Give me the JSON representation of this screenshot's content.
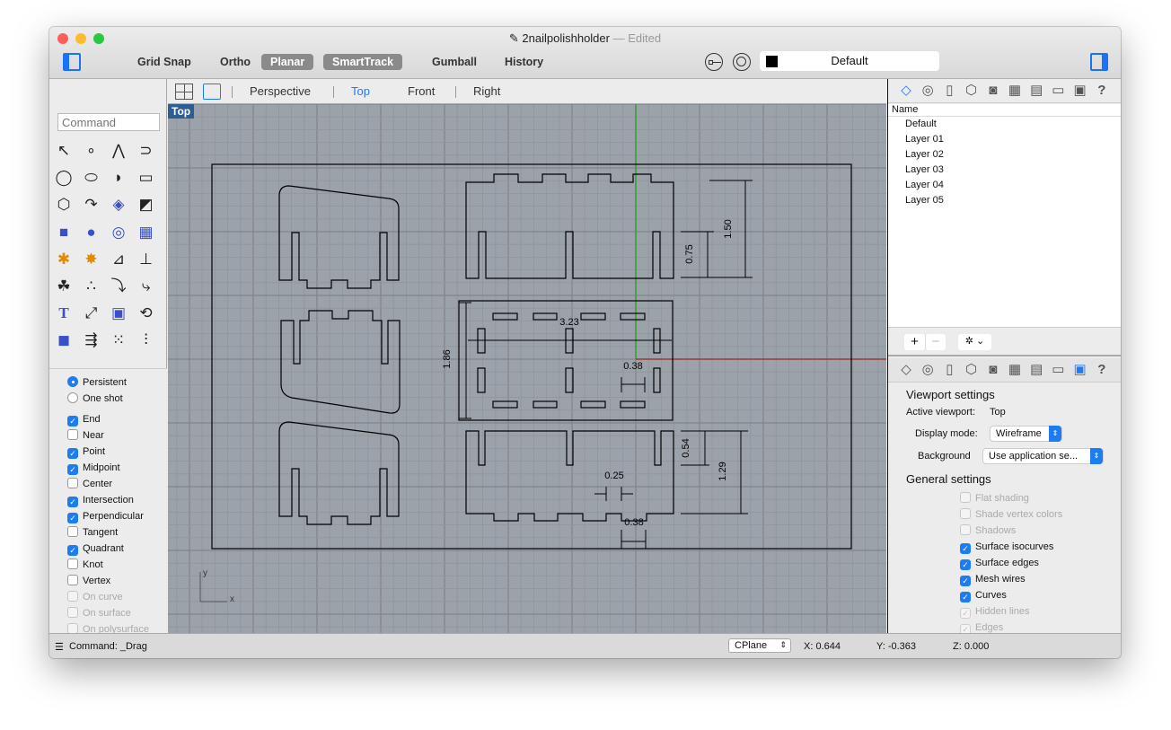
{
  "window": {
    "title": "2nailpolishholder",
    "edited": "— Edited"
  },
  "toolbar": {
    "buttons": [
      {
        "label": "Grid Snap",
        "on": false
      },
      {
        "label": "Ortho",
        "on": false
      },
      {
        "label": "Planar",
        "on": true
      },
      {
        "label": "SmartTrack",
        "on": true
      },
      {
        "label": "Gumball",
        "on": false
      },
      {
        "label": "History",
        "on": false
      }
    ],
    "layer": "Default"
  },
  "command": {
    "placeholder": "Command"
  },
  "tools": [
    "select-arrow",
    "point",
    "polyline",
    "curve",
    "circle",
    "ellipse",
    "arc",
    "rectangle",
    "polygon",
    "fillet",
    "surface-from-points",
    "sweep-surface",
    "box",
    "spheres",
    "cylinder",
    "patch-surface",
    "boolean",
    "explode",
    "trim",
    "split",
    "boolean-union",
    "points-on-curve",
    "offset-curve",
    "blend-curve",
    "text",
    "move",
    "array-blocks",
    "rotate",
    "extrude-solid",
    "dimension",
    "grid-array",
    "section",
    "more"
  ],
  "osnap": {
    "modes": [
      {
        "label": "Persistent",
        "selected": true
      },
      {
        "label": "One shot",
        "selected": false
      }
    ],
    "items": [
      {
        "label": "End",
        "checked": true
      },
      {
        "label": "Near",
        "checked": false
      },
      {
        "label": "Point",
        "checked": true
      },
      {
        "label": "Midpoint",
        "checked": true
      },
      {
        "label": "Center",
        "checked": false
      },
      {
        "label": "Intersection",
        "checked": true
      },
      {
        "label": "Perpendicular",
        "checked": true
      },
      {
        "label": "Tangent",
        "checked": false
      },
      {
        "label": "Quadrant",
        "checked": true
      },
      {
        "label": "Knot",
        "checked": false
      },
      {
        "label": "Vertex",
        "checked": false
      },
      {
        "label": "On curve",
        "checked": false,
        "disabled": true
      },
      {
        "label": "On surface",
        "checked": false,
        "disabled": true
      },
      {
        "label": "On polysurface",
        "checked": false,
        "disabled": true
      }
    ]
  },
  "viewport_tabs": [
    {
      "label": "Perspective",
      "active": false
    },
    {
      "label": "Top",
      "active": true
    },
    {
      "label": "Front",
      "active": false
    },
    {
      "label": "Right",
      "active": false
    }
  ],
  "viewport": {
    "name": "Top",
    "axis_x": "x",
    "axis_y": "y",
    "dimensions": {
      "d150": "1.50",
      "d075": "0.75",
      "d186": "1.86",
      "d323": "3.23",
      "d038a": "0.38",
      "d054": "0.54",
      "d129": "1.29",
      "d025": "0.25",
      "d038b": "0.38"
    }
  },
  "layers": {
    "header": "Name",
    "items": [
      "Default",
      "Layer 01",
      "Layer 02",
      "Layer 03",
      "Layer 04",
      "Layer 05"
    ]
  },
  "panel_tabs": [
    "layers",
    "materials",
    "document",
    "object-properties",
    "camera",
    "grid",
    "notes",
    "viewport",
    "display",
    "help"
  ],
  "viewport_settings": {
    "title": "Viewport settings",
    "active_label": "Active viewport:",
    "active_value": "Top",
    "display_label": "Display mode:",
    "display_value": "Wireframe",
    "background_label": "Background",
    "background_value": "Use application se...",
    "general_title": "General settings",
    "items": [
      {
        "label": "Flat shading",
        "checked": false,
        "disabled": true
      },
      {
        "label": "Shade vertex colors",
        "checked": false,
        "disabled": true
      },
      {
        "label": "Shadows",
        "checked": false,
        "disabled": true
      },
      {
        "label": "Surface isocurves",
        "checked": true
      },
      {
        "label": "Surface edges",
        "checked": true
      },
      {
        "label": "Mesh wires",
        "checked": true
      },
      {
        "label": "Curves",
        "checked": true
      },
      {
        "label": "Hidden lines",
        "checked": true,
        "disabled": true
      },
      {
        "label": "Edges",
        "checked": true,
        "disabled": true
      }
    ]
  },
  "status": {
    "command": "Command: _Drag",
    "cplane": "CPlane",
    "x": "X: 0.644",
    "y": "Y: -0.363",
    "z": "Z: 0.000"
  },
  "colors": {
    "accent": "#1e7cf2",
    "viewport_bg": "#9ca2aa",
    "x_axis": "#9b3a3a",
    "y_axis": "#3a9b3a"
  }
}
